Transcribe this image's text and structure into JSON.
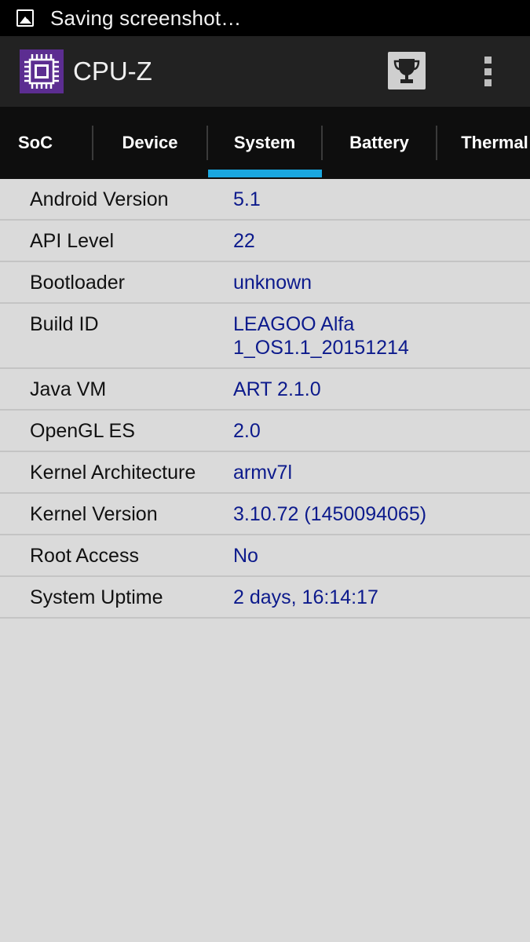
{
  "status_bar": {
    "notification_text": "Saving screenshot…",
    "notification_icon": "image-icon"
  },
  "app_bar": {
    "title": "CPU-Z",
    "logo_icon": "cpu-chip-icon",
    "trophy_icon": "trophy-icon",
    "menu_icon": "more-vertical-icon",
    "logo_color": "#5c2d91"
  },
  "tabs": [
    {
      "label": "SoC"
    },
    {
      "label": "Device"
    },
    {
      "label": "System"
    },
    {
      "label": "Battery"
    },
    {
      "label": "Thermal"
    }
  ],
  "active_tab": "System",
  "accent_color": "#1aa7e0",
  "value_color": "#0c1a8c",
  "rows": [
    {
      "label": "Android Version",
      "value": "5.1"
    },
    {
      "label": "API Level",
      "value": "22"
    },
    {
      "label": "Bootloader",
      "value": "unknown"
    },
    {
      "label": "Build ID",
      "value": "LEAGOO Alfa\n1_OS1.1_20151214"
    },
    {
      "label": "Java VM",
      "value": "ART 2.1.0"
    },
    {
      "label": "OpenGL ES",
      "value": "2.0"
    },
    {
      "label": "Kernel Architecture",
      "value": "armv7l"
    },
    {
      "label": "Kernel Version",
      "value": "3.10.72 (1450094065)"
    },
    {
      "label": "Root Access",
      "value": "No"
    },
    {
      "label": "System Uptime",
      "value": "2 days, 16:14:17"
    }
  ]
}
